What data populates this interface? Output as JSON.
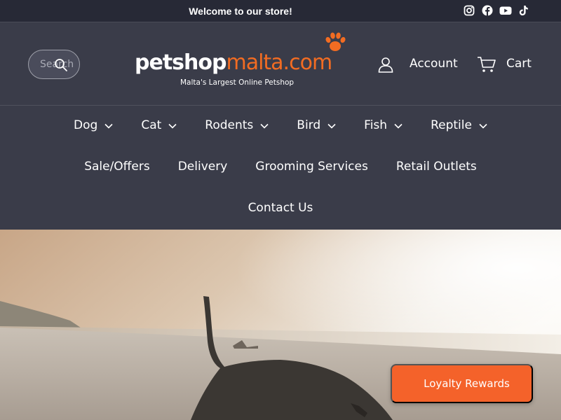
{
  "announcement": {
    "text": "Welcome to our store!"
  },
  "social": {
    "icons": [
      "instagram-icon",
      "facebook-icon",
      "youtube-icon",
      "tiktok-icon"
    ]
  },
  "search": {
    "placeholder": "Search"
  },
  "logo": {
    "pet": "petshop",
    "malta": "malta.com",
    "tagline": "Malta's Largest Online Petshop"
  },
  "header": {
    "account_label": "Account",
    "cart_label": "Cart"
  },
  "nav": {
    "row1": [
      "Dog",
      "Cat",
      "Rodents",
      "Bird",
      "Fish",
      "Reptile"
    ],
    "row2": [
      "Sale/Offers",
      "Delivery",
      "Grooming Services",
      "Retail Outlets"
    ],
    "row3": [
      "Contact Us"
    ]
  },
  "loyalty": {
    "label": "Loyalty Rewards"
  },
  "colors": {
    "brand_orange": "#f26c22",
    "header_bg": "#3a3c49",
    "announce_bg": "#272936",
    "loyalty_bg": "#f4622a"
  }
}
